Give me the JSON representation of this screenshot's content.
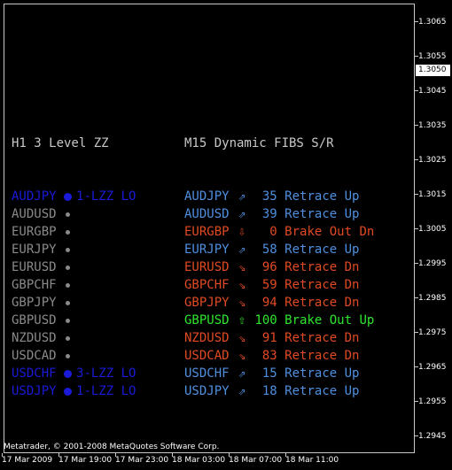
{
  "price_axis": {
    "current": "1.3050",
    "levels": [
      "1.3065",
      "1.3055",
      "1.3045",
      "1.3035",
      "1.3025",
      "1.3015",
      "1.3005",
      "1.2995",
      "1.2985",
      "1.2975",
      "1.2965",
      "1.2955",
      "1.2945"
    ]
  },
  "time_axis": [
    "17 Mar 2009",
    "17 Mar 19:00",
    "17 Mar 23:00",
    "18 Mar 03:00",
    "18 Mar 07:00",
    "18 Mar 11:00"
  ],
  "copyright": "Metatrader, © 2001-2008 MetaQuotes Software Corp.",
  "left_panel": {
    "title": "H1 3 Level ZZ",
    "rows": [
      {
        "pair": "AUDJPY",
        "status": "1-LZZ LO",
        "active": true
      },
      {
        "pair": "AUDUSD",
        "status": "",
        "active": false
      },
      {
        "pair": "EURGBP",
        "status": "",
        "active": false
      },
      {
        "pair": "EURJPY",
        "status": "",
        "active": false
      },
      {
        "pair": "EURUSD",
        "status": "",
        "active": false
      },
      {
        "pair": "GBPCHF",
        "status": "",
        "active": false
      },
      {
        "pair": "GBPJPY",
        "status": "",
        "active": false
      },
      {
        "pair": "GBPUSD",
        "status": "",
        "active": false
      },
      {
        "pair": "NZDUSD",
        "status": "",
        "active": false
      },
      {
        "pair": "USDCAD",
        "status": "",
        "active": false
      },
      {
        "pair": "USDCHF",
        "status": "3-LZZ LO",
        "active": true
      },
      {
        "pair": "USDJPY",
        "status": "1-LZZ LO",
        "active": true
      }
    ]
  },
  "right_panel": {
    "title": "M15 Dynamic FIBS S/R",
    "rows": [
      {
        "pair": "AUDJPY",
        "arrow": "⇗",
        "value": "35",
        "signal": "Retrace Up",
        "color": "#4f8fe0"
      },
      {
        "pair": "AUDUSD",
        "arrow": "⇗",
        "value": "39",
        "signal": "Retrace Up",
        "color": "#4f8fe0"
      },
      {
        "pair": "EURGBP",
        "arrow": "⇩",
        "value": "0",
        "signal": "Brake Out Dn",
        "color": "#e14a22"
      },
      {
        "pair": "EURJPY",
        "arrow": "⇗",
        "value": "58",
        "signal": "Retrace Up",
        "color": "#4f8fe0"
      },
      {
        "pair": "EURUSD",
        "arrow": "⇘",
        "value": "96",
        "signal": "Retrace Dn",
        "color": "#e14a22"
      },
      {
        "pair": "GBPCHF",
        "arrow": "⇘",
        "value": "59",
        "signal": "Retrace Dn",
        "color": "#e14a22"
      },
      {
        "pair": "GBPJPY",
        "arrow": "⇘",
        "value": "94",
        "signal": "Retrace Dn",
        "color": "#e14a22"
      },
      {
        "pair": "GBPUSD",
        "arrow": "⇧",
        "value": "100",
        "signal": "Brake Out Up",
        "color": "#2ee62e"
      },
      {
        "pair": "NZDUSD",
        "arrow": "⇘",
        "value": "91",
        "signal": "Retrace Dn",
        "color": "#e14a22"
      },
      {
        "pair": "USDCAD",
        "arrow": "⇘",
        "value": "83",
        "signal": "Retrace Dn",
        "color": "#e14a22"
      },
      {
        "pair": "USDCHF",
        "arrow": "⇗",
        "value": "15",
        "signal": "Retrace Up",
        "color": "#4f8fe0"
      },
      {
        "pair": "USDJPY",
        "arrow": "⇗",
        "value": "18",
        "signal": "Retrace Up",
        "color": "#4f8fe0"
      }
    ]
  }
}
